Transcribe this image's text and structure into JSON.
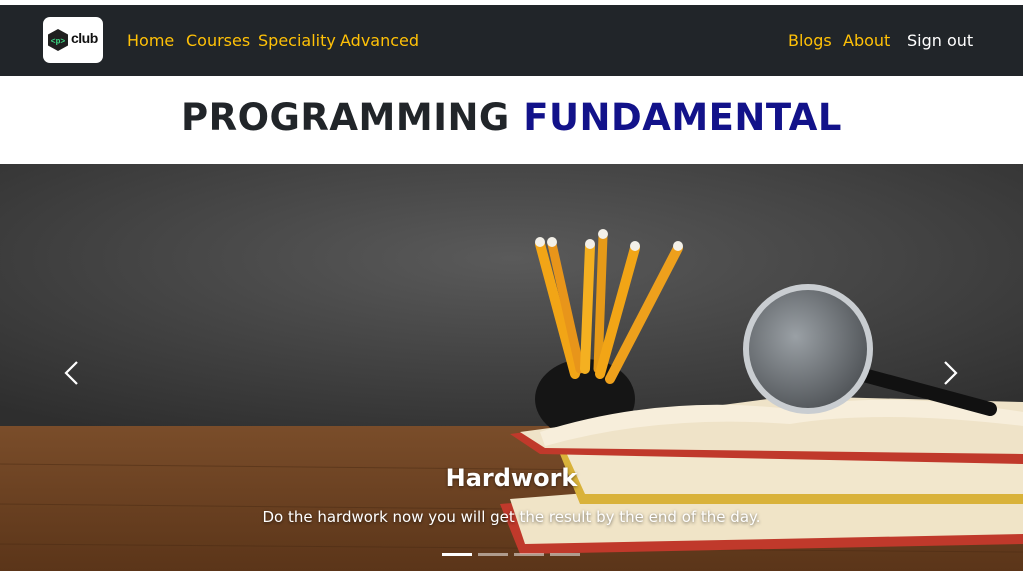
{
  "navbar": {
    "logo_text": "club",
    "logo_code": "<p>",
    "links_left": [
      "Home",
      "Courses",
      "Speciality",
      "Advanced"
    ],
    "links_right": [
      "Blogs",
      "About"
    ],
    "signout": "Sign out",
    "link_color": "#ffc107",
    "bg_color": "#212529"
  },
  "heading": {
    "part1": "PROGRAMMING",
    "part2": "FUNDAMENTAL",
    "accent_color": "#12128a"
  },
  "carousel": {
    "slide_title": "Hardwork",
    "slide_text": "Do the hardwork now you will get the result by the end of the day.",
    "indicator_count": 4,
    "active_index": 0,
    "prev_icon": "chevron-left-icon",
    "next_icon": "chevron-right-icon"
  }
}
